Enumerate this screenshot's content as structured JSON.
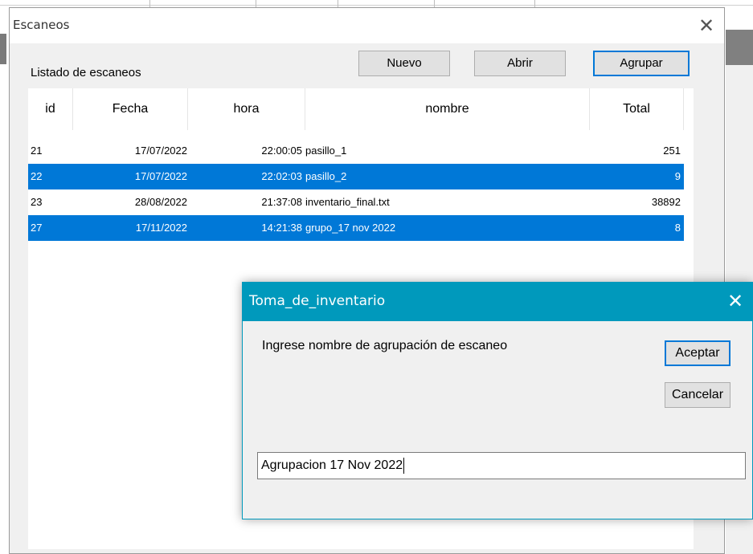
{
  "window": {
    "title": "Escaneos",
    "close_glyph": "✕",
    "list_label": "Listado de escaneos",
    "buttons": {
      "nuevo": "Nuevo",
      "abrir": "Abrir",
      "agrupar": "Agrupar"
    }
  },
  "table": {
    "columns": [
      "id",
      "Fecha",
      "hora",
      "nombre",
      "Total"
    ],
    "rows": [
      {
        "id": "21",
        "fecha": "17/07/2022",
        "hora": "22:00:05",
        "nombre": "pasillo_1",
        "total": "251",
        "selected": false
      },
      {
        "id": "22",
        "fecha": "17/07/2022",
        "hora": "22:02:03",
        "nombre": "pasillo_2",
        "total": "9",
        "selected": true
      },
      {
        "id": "23",
        "fecha": "28/08/2022",
        "hora": "21:37:08",
        "nombre": "inventario_final.txt",
        "total": "38892",
        "selected": false
      },
      {
        "id": "27",
        "fecha": "17/11/2022",
        "hora": "14:21:38",
        "nombre": "grupo_17 nov 2022",
        "total": "8",
        "selected": true
      }
    ]
  },
  "dialog": {
    "title": "Toma_de_inventario",
    "close_glyph": "✕",
    "prompt": "Ingrese nombre de agrupación de escaneo",
    "accept": "Aceptar",
    "cancel": "Cancelar",
    "input_value": "Agrupacion 17 Nov 2022"
  },
  "colors": {
    "selection": "#0078d7",
    "dialog_title": "#0099bc"
  }
}
